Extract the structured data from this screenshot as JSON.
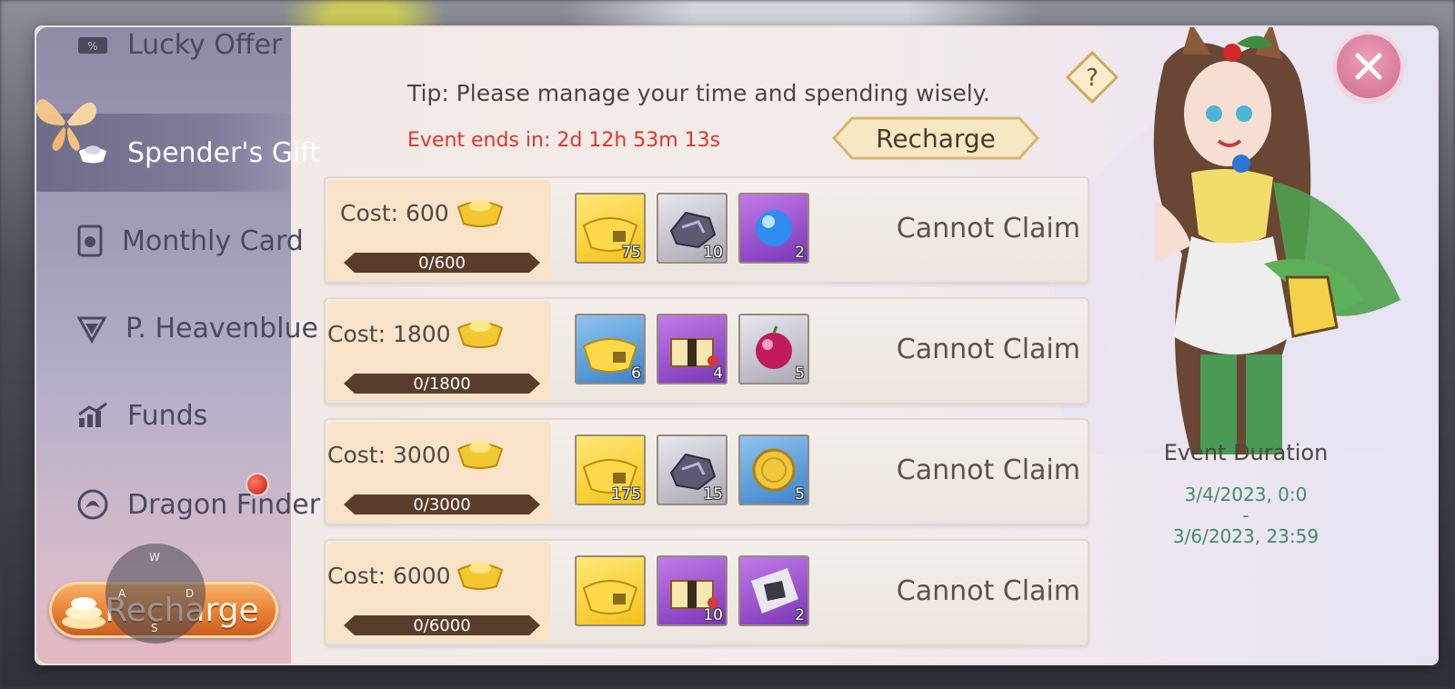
{
  "sidebar": {
    "items": [
      {
        "label": "Lucky Offer",
        "icon": "lucky-offer-icon"
      },
      {
        "label": "Spender's Gift",
        "icon": "ingot-icon",
        "active": true
      },
      {
        "label": "Monthly Card",
        "icon": "card-icon"
      },
      {
        "label": "P. Heavenblue",
        "icon": "gem-shield-icon"
      },
      {
        "label": "Funds",
        "icon": "chart-up-icon"
      },
      {
        "label": "Dragon Finder",
        "icon": "dragon-icon",
        "badge": true
      }
    ],
    "recharge_label": "Recharge",
    "joystick": {
      "up": "W",
      "left": "A",
      "right": "D",
      "down": "S"
    }
  },
  "header": {
    "tip": "Tip: Please manage your time and spending wisely.",
    "event_ends": "Event ends in: 2d 12h 53m 13s",
    "recharge_label": "Recharge",
    "help_icon": "question-icon",
    "close_icon": "close-icon"
  },
  "tiers": [
    {
      "cost": "Cost: 600",
      "progress": "0/600",
      "status": "Cannot Claim",
      "rewards": [
        {
          "type": "gold",
          "item": "locked-ingot",
          "qty": "75"
        },
        {
          "type": "gray",
          "item": "ore",
          "qty": "10"
        },
        {
          "type": "purple",
          "item": "blue-orb",
          "qty": "2"
        }
      ]
    },
    {
      "cost": "Cost: 1800",
      "progress": "0/1800",
      "status": "Cannot Claim",
      "rewards": [
        {
          "type": "blue",
          "item": "locked-ingot",
          "qty": "6"
        },
        {
          "type": "purple",
          "item": "chest",
          "qty": "4"
        },
        {
          "type": "gray",
          "item": "red-orb",
          "qty": "5"
        }
      ]
    },
    {
      "cost": "Cost: 3000",
      "progress": "0/3000",
      "status": "Cannot Claim",
      "rewards": [
        {
          "type": "gold",
          "item": "locked-ingot",
          "qty": "175"
        },
        {
          "type": "gray",
          "item": "ore",
          "qty": "15"
        },
        {
          "type": "blue",
          "item": "coin",
          "qty": "5"
        }
      ]
    },
    {
      "cost": "Cost: 6000",
      "progress": "0/6000",
      "status": "Cannot Claim",
      "rewards": [
        {
          "type": "gold",
          "item": "locked-ingot",
          "qty": ""
        },
        {
          "type": "purple",
          "item": "chest",
          "qty": "10"
        },
        {
          "type": "purple",
          "item": "dark-shard",
          "qty": "2"
        }
      ]
    }
  ],
  "duration": {
    "title": "Event Duration",
    "start": "3/4/2023, 0:0",
    "separator": "-",
    "end": "3/6/2023, 23:59"
  },
  "colors": {
    "accent_red": "#e0362c",
    "date_green": "#3e8b6c",
    "progress_bar": "#5a3c2a"
  }
}
